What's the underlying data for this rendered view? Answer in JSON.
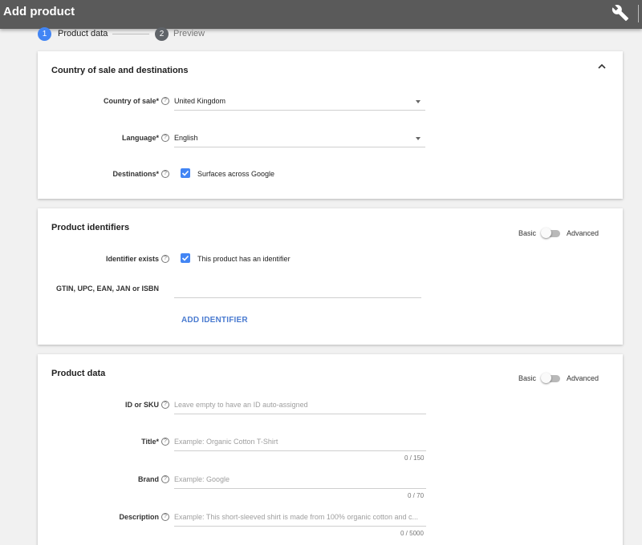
{
  "appbar": {
    "title": "Add product",
    "icon": "wrench-icon"
  },
  "stepper": {
    "steps": [
      {
        "number": "1",
        "label": "Product data",
        "active": true
      },
      {
        "number": "2",
        "label": "Preview",
        "active": false
      }
    ]
  },
  "cards": {
    "country": {
      "title": "Country of sale and destinations",
      "fields": {
        "country_label": "Country of sale*",
        "country_value": "United Kingdom",
        "language_label": "Language*",
        "language_value": "English",
        "destinations_label": "Destinations*",
        "destinations_checkbox": "Surfaces across Google"
      }
    },
    "identifiers": {
      "title": "Product identifiers",
      "toggle": {
        "left": "Basic",
        "right": "Advanced"
      },
      "fields": {
        "identifier_exists_label": "Identifier exists",
        "identifier_checkbox": "This product has an identifier",
        "gtin_label": "GTIN, UPC, EAN, JAN or ISBN",
        "add_identifier": "ADD IDENTIFIER"
      }
    },
    "product_data": {
      "title": "Product data",
      "toggle": {
        "left": "Basic",
        "right": "Advanced"
      },
      "fields": {
        "id_label": "ID or SKU",
        "id_placeholder": "Leave empty to have an ID auto-assigned",
        "title_label": "Title*",
        "title_placeholder": "Example: Organic Cotton T-Shirt",
        "title_counter": "0 / 150",
        "brand_label": "Brand",
        "brand_placeholder": "Example: Google",
        "brand_counter": "0 / 70",
        "description_label": "Description",
        "description_placeholder": "Example: This short-sleeved shirt is made from 100% organic cotton and c...",
        "description_counter": "0 / 5000"
      }
    }
  },
  "colors": {
    "accent": "#4285f4",
    "appbar": "#5a5a5a",
    "link": "#4a7bd0"
  }
}
